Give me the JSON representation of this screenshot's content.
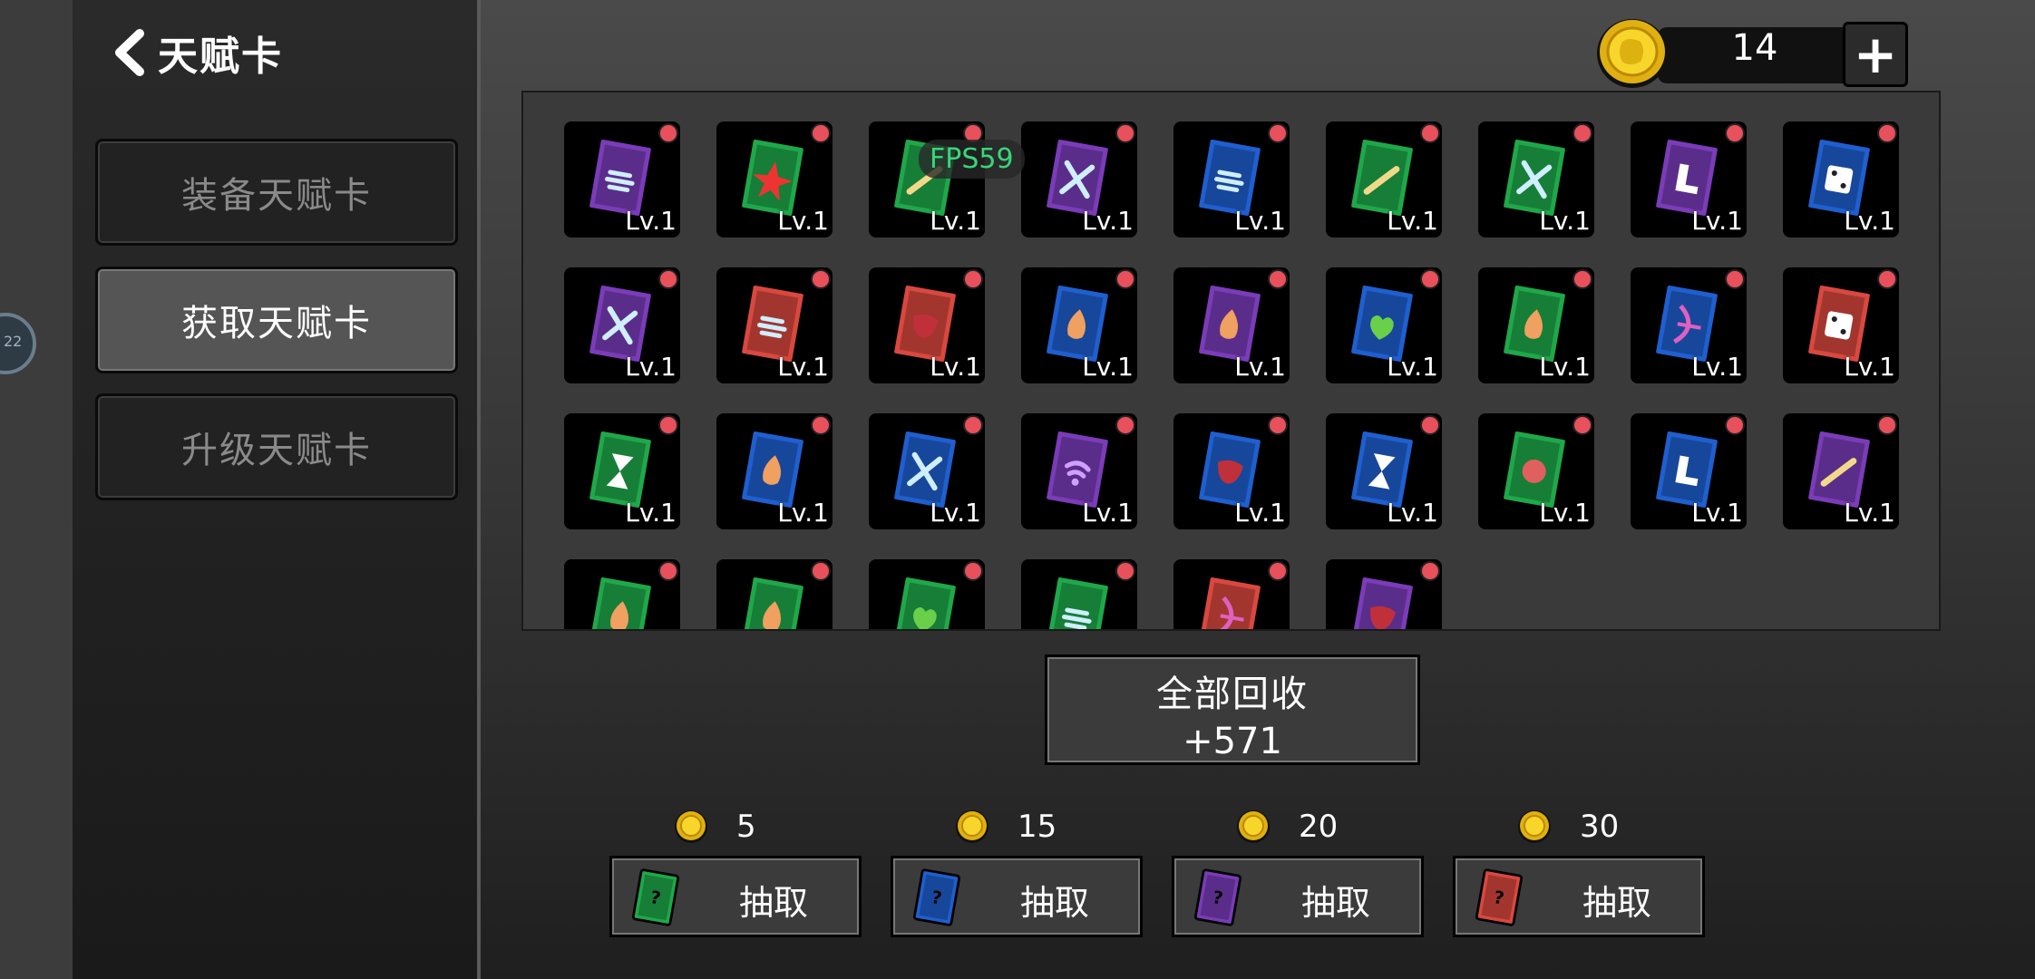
{
  "header": {
    "title": "天赋卡"
  },
  "side_badge": "22",
  "menu": [
    {
      "label": "装备天赋卡",
      "active": false
    },
    {
      "label": "获取天赋卡",
      "active": true
    },
    {
      "label": "升级天赋卡",
      "active": false
    }
  ],
  "currency": {
    "count": "14",
    "add": "+"
  },
  "fps": "FPS59",
  "cards": [
    {
      "color": "purple",
      "icon": "wind",
      "level": "Lv.1"
    },
    {
      "color": "green",
      "icon": "star",
      "level": "Lv.1"
    },
    {
      "color": "green",
      "icon": "sword",
      "level": "Lv.1"
    },
    {
      "color": "purple",
      "icon": "bones",
      "level": "Lv.1"
    },
    {
      "color": "blue",
      "icon": "wind",
      "level": "Lv.1"
    },
    {
      "color": "green",
      "icon": "sword",
      "level": "Lv.1"
    },
    {
      "color": "green",
      "icon": "bones",
      "level": "Lv.1"
    },
    {
      "color": "purple",
      "icon": "boot",
      "level": "Lv.1"
    },
    {
      "color": "blue",
      "icon": "dice",
      "level": "Lv.1"
    },
    {
      "color": "purple",
      "icon": "bones",
      "level": "Lv.1"
    },
    {
      "color": "red",
      "icon": "wind",
      "level": "Lv.1"
    },
    {
      "color": "red",
      "icon": "mouth",
      "level": "Lv.1"
    },
    {
      "color": "blue",
      "icon": "flame",
      "level": "Lv.1"
    },
    {
      "color": "purple",
      "icon": "flame",
      "level": "Lv.1"
    },
    {
      "color": "blue",
      "icon": "heart",
      "level": "Lv.1"
    },
    {
      "color": "green",
      "icon": "flame",
      "level": "Lv.1"
    },
    {
      "color": "blue",
      "icon": "bow",
      "level": "Lv.1"
    },
    {
      "color": "red",
      "icon": "dice",
      "level": "Lv.1"
    },
    {
      "color": "green",
      "icon": "hourglass",
      "level": "Lv.1"
    },
    {
      "color": "blue",
      "icon": "flame",
      "level": "Lv.1"
    },
    {
      "color": "blue",
      "icon": "bones",
      "level": "Lv.1"
    },
    {
      "color": "purple",
      "icon": "signal",
      "level": "Lv.1"
    },
    {
      "color": "blue",
      "icon": "mouth",
      "level": "Lv.1"
    },
    {
      "color": "blue",
      "icon": "hourglass",
      "level": "Lv.1"
    },
    {
      "color": "green",
      "icon": "fist",
      "level": "Lv.1"
    },
    {
      "color": "blue",
      "icon": "boot",
      "level": "Lv.1"
    },
    {
      "color": "purple",
      "icon": "sword",
      "level": "Lv.1"
    },
    {
      "color": "green",
      "icon": "flame",
      "level": ""
    },
    {
      "color": "green",
      "icon": "flame",
      "level": ""
    },
    {
      "color": "green",
      "icon": "heart",
      "level": ""
    },
    {
      "color": "green",
      "icon": "wind",
      "level": ""
    },
    {
      "color": "red",
      "icon": "bow",
      "level": ""
    },
    {
      "color": "purple",
      "icon": "mouth",
      "level": ""
    }
  ],
  "recycle": {
    "line1": "全部回收",
    "line2": "+571"
  },
  "draws": [
    {
      "price": "5",
      "color": "green",
      "label": "抽取"
    },
    {
      "price": "15",
      "color": "blue",
      "label": "抽取"
    },
    {
      "price": "20",
      "color": "purple",
      "label": "抽取"
    },
    {
      "price": "30",
      "color": "red",
      "label": "抽取"
    }
  ],
  "colors": {
    "green": "#1fa84a",
    "blue": "#1f5fcf",
    "purple": "#7a3cb8",
    "red": "#d9483f",
    "gold": "#f3c81a"
  }
}
